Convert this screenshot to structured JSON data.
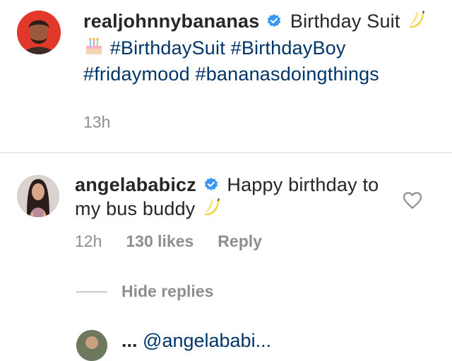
{
  "post": {
    "username": "realjohnnybananas",
    "caption_prefix": "Birthday Suit",
    "hashtags": [
      "#BirthdaySuit",
      "#BirthdayBoy",
      "#fridaymood",
      "#bananasdoingthings"
    ],
    "time": "13h",
    "avatar_icon": "profile-photo-icon",
    "verified_icon": "verified-badge-icon"
  },
  "comment": {
    "username": "angelababicz",
    "text": "Happy birthday to my bus buddy",
    "time": "12h",
    "likes": "130 likes",
    "reply_label": "Reply",
    "like_icon": "heart-outline-icon"
  },
  "replies": {
    "toggle_label": "Hide replies"
  },
  "reply_preview": {
    "username": "...",
    "mention": "@angelababi..."
  },
  "colors": {
    "text": "#262626",
    "secondary": "#8e8e8e",
    "hashtag": "#003569",
    "verified": "#3897f0",
    "divider": "#dbdbdb"
  }
}
